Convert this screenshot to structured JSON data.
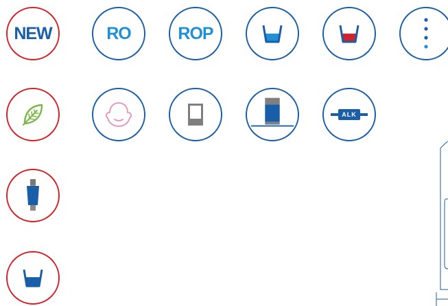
{
  "labels": {
    "new": "NEW",
    "ro": "RO",
    "rop": "ROP",
    "alk": "ALK"
  },
  "icons": [
    {
      "name": "new-badge-icon",
      "border": "red"
    },
    {
      "name": "ro-badge-icon",
      "border": "blue"
    },
    {
      "name": "rop-badge-icon",
      "border": "blue"
    },
    {
      "name": "glass-blue-water-icon",
      "border": "blue"
    },
    {
      "name": "glass-red-water-icon",
      "border": "blue"
    },
    {
      "name": "more-dots-icon",
      "border": "blue"
    },
    {
      "name": "leaf-icon",
      "border": "red"
    },
    {
      "name": "face-icon",
      "border": "blue"
    },
    {
      "name": "filter-cartridge-icon",
      "border": "blue"
    },
    {
      "name": "filter-cartridge-base-icon",
      "border": "blue"
    },
    {
      "name": "alk-cartridge-icon",
      "border": "blue"
    },
    {
      "name": "threaded-filter-icon",
      "border": "red"
    },
    {
      "name": "glass-dark-water-icon",
      "border": "red"
    }
  ],
  "colors": {
    "red": "#d2232a",
    "blue": "#1a5ea8",
    "light_blue": "#1f8fd6",
    "green": "#7ab648",
    "pink": "#e58fb6",
    "grey": "#8a8a8a"
  }
}
